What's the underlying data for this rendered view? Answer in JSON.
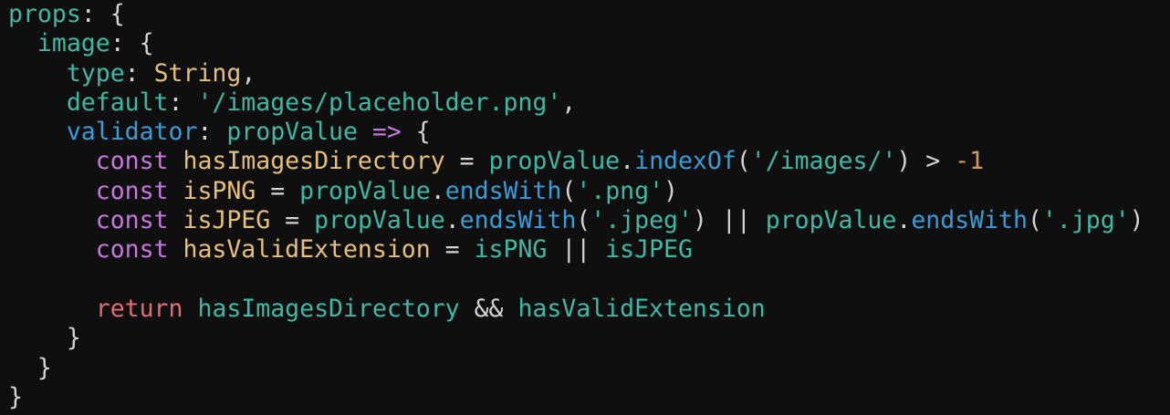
{
  "code": {
    "l1": {
      "a": "props",
      "b": ": {"
    },
    "l2": {
      "indent": "  ",
      "a": "image",
      "b": ": {"
    },
    "l3": {
      "indent": "    ",
      "a": "type",
      "b": ": ",
      "c": "String",
      "d": ","
    },
    "l4": {
      "indent": "    ",
      "a": "default",
      "b": ": ",
      "c": "'/images/placeholder.png'",
      "d": ","
    },
    "l5": {
      "indent": "    ",
      "a": "validator",
      "b": ": ",
      "c": "propValue",
      "d": " ",
      "e": "=>",
      "f": " {"
    },
    "l6": {
      "indent": "      ",
      "kw": "const",
      "name": "hasImagesDirectory",
      "eq": " = ",
      "obj": "propValue",
      "dot": ".",
      "method": "indexOf",
      "open": "(",
      "str": "'/images/'",
      "close": ")",
      "op": " > ",
      "minus": "-",
      "num": "1"
    },
    "l7": {
      "indent": "      ",
      "kw": "const",
      "name": "isPNG",
      "eq": " = ",
      "obj": "propValue",
      "dot": ".",
      "method": "endsWith",
      "open": "(",
      "str": "'.png'",
      "close": ")"
    },
    "l8": {
      "indent": "      ",
      "kw": "const",
      "name": "isJPEG",
      "eq": " = ",
      "obj": "propValue",
      "dot": ".",
      "method": "endsWith",
      "open": "(",
      "str": "'.jpeg'",
      "close": ")",
      "or": " || ",
      "obj2": "propValue",
      "dot2": ".",
      "method2": "endsWith",
      "open2": "(",
      "str2": "'.jpg'",
      "close2": ")"
    },
    "l9": {
      "indent": "      ",
      "kw": "const",
      "name": "hasValidExtension",
      "eq": " = ",
      "a": "isPNG",
      "or": " || ",
      "b": "isJPEG"
    },
    "l10": {
      "indent": ""
    },
    "l11": {
      "indent": "      ",
      "kw": "return",
      "a": "hasImagesDirectory",
      "and": " && ",
      "b": "hasValidExtension"
    },
    "l12": {
      "indent": "    ",
      "brace": "}"
    },
    "l13": {
      "indent": "  ",
      "brace": "}"
    },
    "l14": {
      "indent": "",
      "brace": "}"
    }
  },
  "colors": {
    "background": "#0f0f0f",
    "property": "#3fb8a4",
    "validator_key": "#3b9bd6",
    "keyword": "#c678dd",
    "return_keyword": "#e06c75",
    "declared_identifier": "#e5c07b",
    "method": "#3b9bd6",
    "string": "#3fb8a4",
    "number": "#d19a66",
    "punctuation": "#d4d4d4"
  }
}
